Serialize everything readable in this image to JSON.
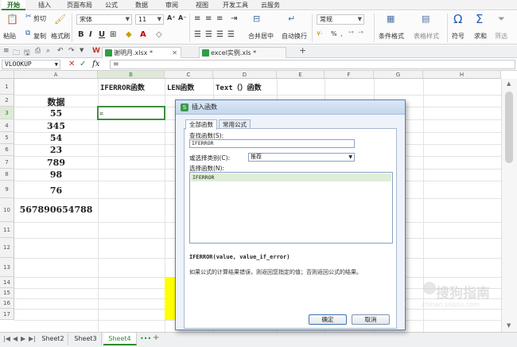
{
  "ribbon_tabs": [
    "开始",
    "插入",
    "页面布局",
    "公式",
    "数据",
    "审阅",
    "视图",
    "开发工具",
    "云服务"
  ],
  "ribbon": {
    "paste": "粘贴",
    "cut": "剪切",
    "copy": "复制",
    "format_painter": "格式刷",
    "font_name": "宋体",
    "font_size": "11",
    "merge_center": "合并居中",
    "wrap_text": "自动换行",
    "number_format": "常规",
    "percent": "%",
    "conditional_format": "条件格式",
    "table_style": "表格样式",
    "symbol": "符号",
    "sum": "求和",
    "filter": "筛选"
  },
  "doc_tabs": [
    {
      "label": "谢明月.xlsx *",
      "active": true
    },
    {
      "label": "excel实例.xls *",
      "active": false
    }
  ],
  "formula_bar": {
    "name_box": "VLOOKUP",
    "cancel": "✕",
    "confirm": "✓",
    "fx": "fx",
    "content": "="
  },
  "columns": [
    "A",
    "B",
    "C",
    "D",
    "E",
    "F",
    "G",
    "H"
  ],
  "rows": [
    "1",
    "2",
    "3",
    "4",
    "5",
    "6",
    "7",
    "8",
    "9",
    "10",
    "11",
    "12",
    "13",
    "14",
    "15",
    "16",
    "17"
  ],
  "cells": {
    "B1": "IFERROR函数",
    "C1": "LEN函数",
    "D1": "Text（）函数",
    "A2": "数据",
    "A3": "55",
    "A4": "345",
    "A5": "54",
    "A6": "23",
    "A7": "789",
    "A8": "98",
    "A9": "76",
    "A10": "567890654788",
    "B3": "="
  },
  "sheet_tabs": [
    {
      "label": "Sheet2",
      "active": false
    },
    {
      "label": "Sheet3",
      "active": false
    },
    {
      "label": "Sheet4",
      "active": true
    }
  ],
  "dialog": {
    "title": "插入函数",
    "tabs": [
      "全部函数",
      "常用公式"
    ],
    "search_label": "查找函数(S):",
    "search_value": "IFERROR",
    "category_label": "或选择类别(C):",
    "category_value": "推荐",
    "select_label": "选择函数(N):",
    "functions": [
      "IFERROR"
    ],
    "syntax": "IFERROR(value, value_if_error)",
    "description": "如果公式的计算结果错误，则返回您指定的值；否则返回公式的结果。",
    "ok": "确定",
    "cancel": "取消"
  },
  "watermark": {
    "text": "搜狗指南",
    "url": "zhinan.sogou.com"
  },
  "colors": {
    "accent": "#2e8b2e",
    "highlight": "#ffff00",
    "dialog_border": "#5c7fa8"
  }
}
